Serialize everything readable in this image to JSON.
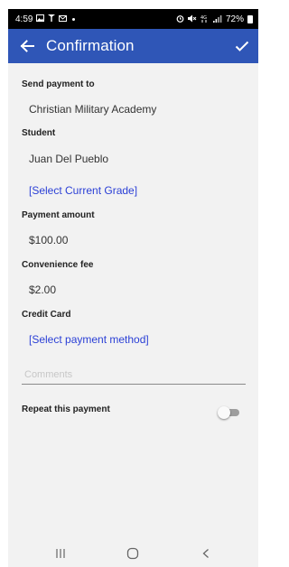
{
  "status_bar": {
    "time": "4:59",
    "battery_percent": "72%",
    "left_icons": [
      "image-icon",
      "antenna-icon",
      "mail-icon",
      "notification-dot"
    ],
    "right_icons": [
      "alarm-icon",
      "mute-icon",
      "network-icon",
      "signal-icon",
      "battery-icon"
    ]
  },
  "app_bar": {
    "title": "Confirmation",
    "back_icon": "arrow-left-icon",
    "confirm_icon": "checkmark-icon",
    "color": "#2f56b7"
  },
  "form": {
    "send_payment_label": "Send payment to",
    "send_payment_value": "Christian Military Academy",
    "student_label": "Student",
    "student_value": "Juan  Del Pueblo",
    "grade_link": "[Select Current Grade]",
    "amount_label": "Payment amount",
    "amount_value": "$100.00",
    "fee_label": "Convenience fee",
    "fee_value": "$2.00",
    "card_label": "Credit Card",
    "card_link": "[Select payment method]",
    "comments_placeholder": "Comments",
    "comments_value": "",
    "repeat_label": "Repeat this payment",
    "repeat_on": false
  },
  "colors": {
    "link": "#2a3fd6",
    "background": "#f2f2f2"
  },
  "nav_bar": {
    "icons": [
      "recent-apps-icon",
      "home-icon",
      "back-nav-icon"
    ]
  }
}
